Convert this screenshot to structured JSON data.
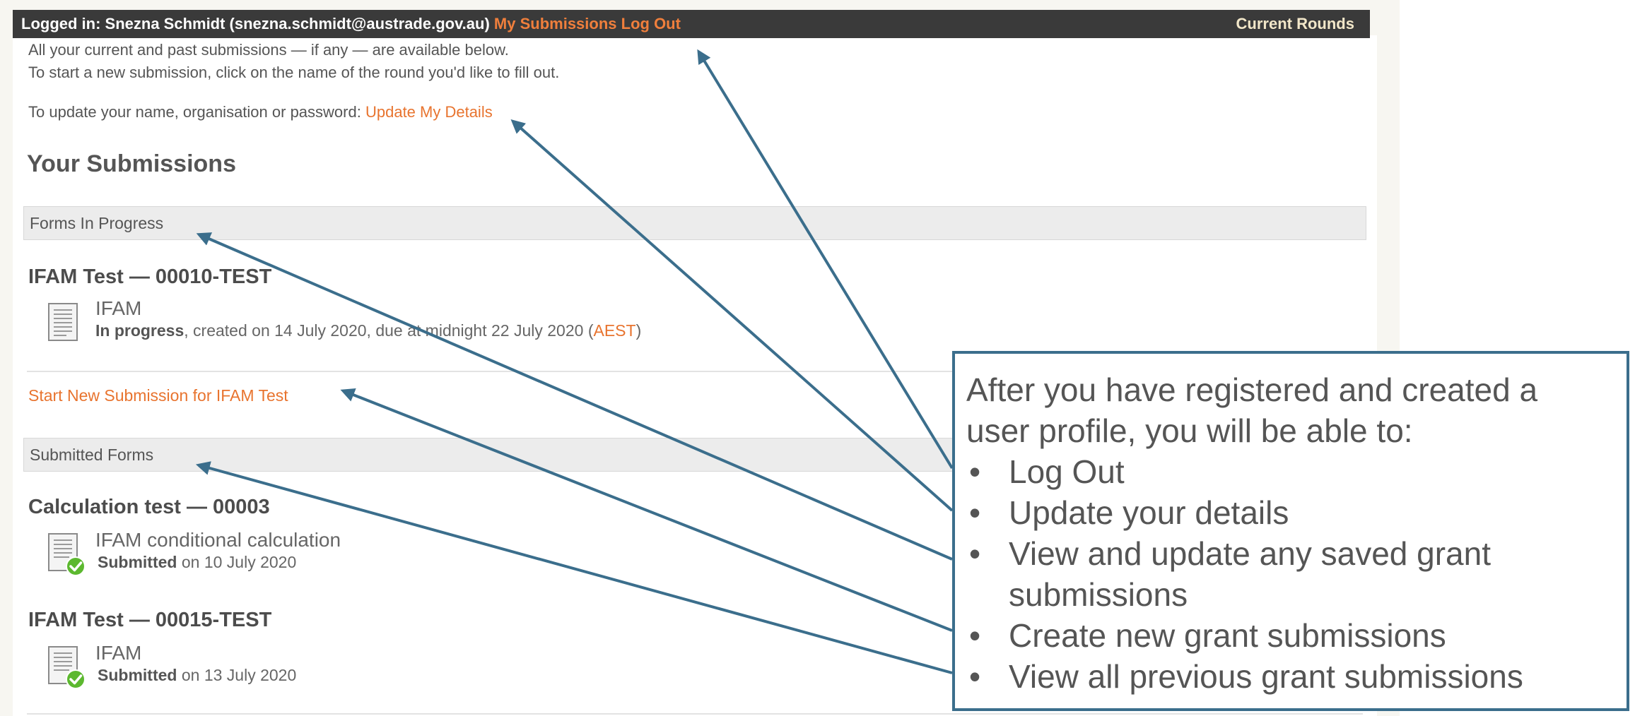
{
  "topbar": {
    "logged_in": "Logged in: Snezna Schmidt (snezna.schmidt@austrade.gov.au)",
    "my_submissions": "My Submissions",
    "log_out": "Log Out",
    "current_rounds": "Current Rounds"
  },
  "intro": {
    "line1": "All your current and past submissions — if any — are available below.",
    "line2": "To start a new submission, click on the name of the round you'd like to fill out.",
    "update_prefix": "To update your name, organisation or password:",
    "update_link": "Update My Details"
  },
  "submissions": {
    "heading": "Your Submissions",
    "in_progress_header": "Forms In Progress",
    "submitted_header": "Submitted Forms",
    "start_new_link": "Start New Submission for IFAM Test",
    "in_progress": [
      {
        "title": "IFAM Test — 00010-TEST",
        "form": "IFAM",
        "status_bold": "In progress",
        "status_rest": ", created on 14 July 2020, due at midnight 22 July 2020 (",
        "timezone": "AEST",
        "status_end": ")"
      }
    ],
    "submitted": [
      {
        "title": "Calculation test — 00003",
        "form": "IFAM conditional calculation",
        "status_bold": "Submitted",
        "status_rest": " on 10 July 2020"
      },
      {
        "title": "IFAM Test — 00015-TEST",
        "form": "IFAM",
        "status_bold": "Submitted",
        "status_rest": " on 13 July 2020"
      }
    ]
  },
  "callout": {
    "intro": "After you have registered and created a user profile, you will be able to:",
    "items": [
      "Log Out",
      "Update your details",
      "View and update any saved grant submissions",
      "Create new grant submissions",
      "View all previous grant submissions"
    ]
  },
  "colors": {
    "accent": "#e8742f",
    "topbar_bg": "#3a3a3a",
    "callout_border": "#3b6e8c",
    "arrow": "#3b6e8c",
    "submitted_check": "#5cb82f"
  },
  "icons": [
    "document-icon",
    "document-submitted-icon",
    "arrow-icon"
  ]
}
